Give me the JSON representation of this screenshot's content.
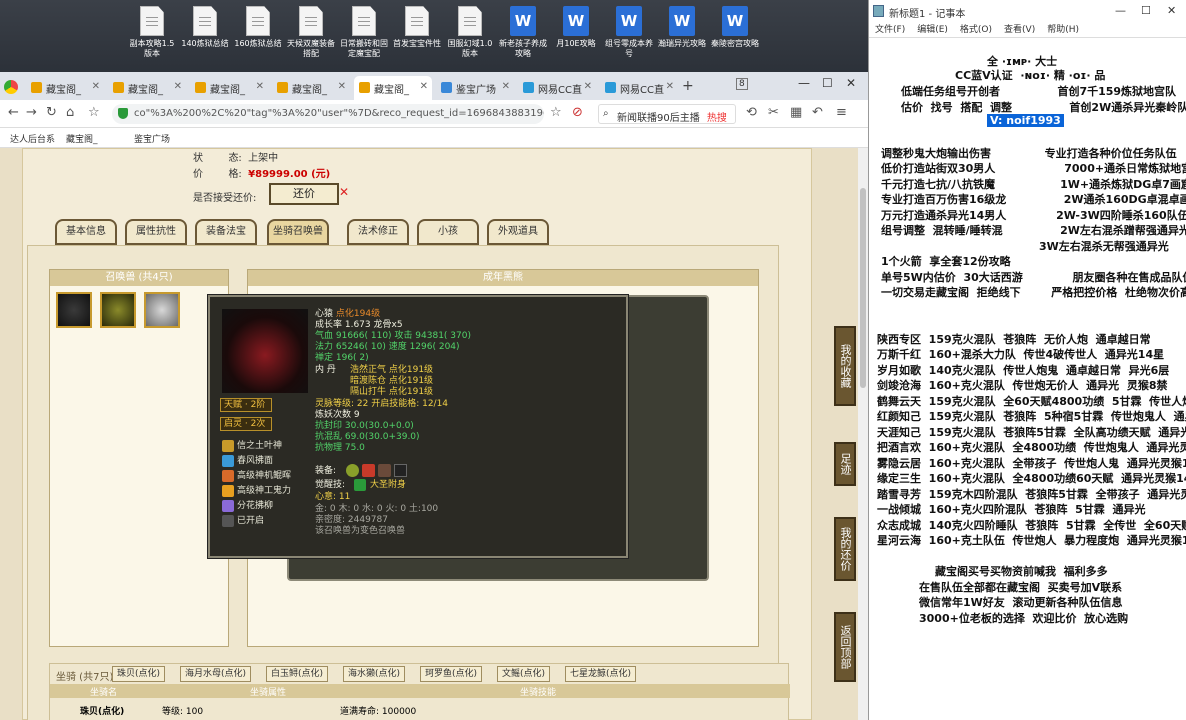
{
  "desktop": {
    "icons": [
      {
        "label": "副本攻略1.5版本",
        "type": "doc"
      },
      {
        "label": "140炼狱总结",
        "type": "doc"
      },
      {
        "label": "160炼狱总结",
        "type": "doc"
      },
      {
        "label": "天候双魔装备搭配",
        "type": "doc"
      },
      {
        "label": "日常搬砖和固定魔宝配",
        "type": "doc"
      },
      {
        "label": "首发宝宝件性",
        "type": "doc"
      },
      {
        "label": "国服幻域1.0版本",
        "type": "doc"
      },
      {
        "label": "新老孩子养成攻略",
        "type": "word"
      },
      {
        "label": "月10E攻略",
        "type": "word"
      },
      {
        "label": "组号零成本养号",
        "type": "word"
      },
      {
        "label": "瀚瑞异光攻略",
        "type": "word"
      },
      {
        "label": "秦陵密宫攻略",
        "type": "word"
      }
    ]
  },
  "browser": {
    "tabs": [
      {
        "label": "藏宝阁_",
        "color": "#e8a000"
      },
      {
        "label": "藏宝阁_",
        "color": "#e8a000"
      },
      {
        "label": "藏宝阁_",
        "color": "#e8a000"
      },
      {
        "label": "藏宝阁_",
        "color": "#e8a000"
      },
      {
        "label": "藏宝阁_",
        "color": "#e8a000"
      },
      {
        "label": "鉴宝广场",
        "color": "#3a88d8"
      },
      {
        "label": "网易CC直",
        "color": "#2a9ad8"
      },
      {
        "label": "网易CC直",
        "color": "#2a9ad8"
      }
    ],
    "tab_count": "8",
    "url": "co\"%3A%200%2C%20\"tag\"%3A%20\"user\"%7D&reco_request_id=1696843883190kgw5e",
    "search_text": "新闻联播90后主播",
    "search_hot": "热搜",
    "bookmarks": [
      "达人后台系",
      "藏宝阁_",
      "鉴宝广场"
    ]
  },
  "page": {
    "status_label": "状",
    "status_label2": "态:",
    "status_value": "上架中",
    "price_label": "价",
    "price_label2": "格:",
    "price_value": "¥89999.00 (元)",
    "bargain_label": "是否接受还价:",
    "bargain_button": "还价",
    "tabs": [
      "基本信息",
      "属性抗性",
      "装备法宝",
      "坐骑召唤兽",
      "法术修正",
      "小孩",
      "外观道具"
    ],
    "summon_panel_title": "召唤兽 (共4只)",
    "right_panel_title": "成年黑熊",
    "side_buttons": [
      "我的收藏",
      "足迹",
      "我的还价",
      "返回顶部"
    ],
    "bottom": {
      "mounts_label": "坐骑 (共7只)",
      "mount_tabs": [
        "珠贝(点化)",
        "海月水母(点化)",
        "白玉鲟(点化)",
        "海水獭(点化)",
        "珂罗鱼(点化)",
        "文鳐(点化)",
        "七星龙鲸(点化)"
      ],
      "col1": "坐骑名",
      "col2": "坐骑属性",
      "col3": "坐骑技能",
      "row_name": "珠贝(点化)",
      "row_level": "等级:  100",
      "row_life": "道满寿命:  100000"
    }
  },
  "tooltip": {
    "name": "心猿",
    "name_suffix": "点化194级",
    "growth": "成长率 1.673  龙骨x5",
    "hp": "气血 91666( 110)",
    "atk": "攻击 94381( 370)",
    "mp": "法力 65246( 10)",
    "spd": "速度 1296( 204)",
    "lock": "禅定 196( 2)",
    "neidan_label": "内    丹",
    "neidan": [
      "浩然正气 点化191级",
      "暗渡陈仓 点化191级",
      "隔山打牛 点化191级"
    ],
    "spirit_level": "灵脉等级: 22  开启技能格: 12/14",
    "refine": "炼妖次数 9",
    "res_seal": "抗封印 30.0(30.0+0.0)",
    "res_chaos": "抗混乱 69.0(30.0+39.0)",
    "res_phys": "抗物理 75.0",
    "equip_label": "装备:",
    "awaken_label": "觉醒技:",
    "awaken_value": "大圣附身",
    "xinyi": "心意: 11",
    "elements": "金: 0  木: 0  水: 0  火: 0  土:100",
    "intimacy": "亲密度: 2449787",
    "converted": "该召唤兽为变色召唤兽",
    "tianfu": "天赋 · 2阶",
    "qiling": "启灵 · 2次",
    "skills": [
      {
        "label": "信之土叶神",
        "color": "#c89a2a"
      },
      {
        "label": "春风拂面",
        "color": "#3a9ad8"
      },
      {
        "label": "高级神机鲲晖",
        "color": "#d86a2a"
      },
      {
        "label": "高级神工鬼力",
        "color": "#e8a020"
      },
      {
        "label": "分花拂柳",
        "color": "#8a6ad8"
      },
      {
        "label": "已开启",
        "color": "#555555"
      }
    ]
  },
  "notepad": {
    "title": "新标题1 - 记事本",
    "menu": [
      "文件(F)",
      "编辑(E)",
      "格式(O)",
      "查看(V)",
      "帮助(H)"
    ],
    "highlight": "V: noif1993"
  }
}
